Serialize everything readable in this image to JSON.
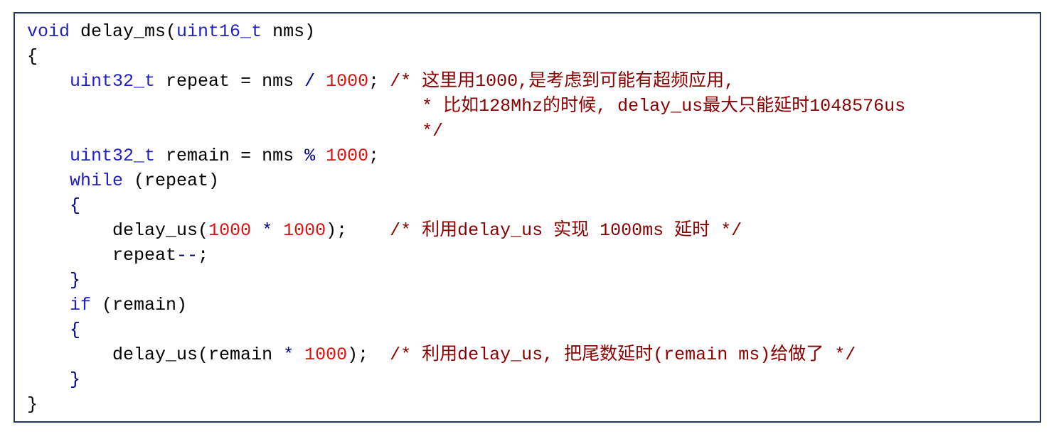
{
  "colors": {
    "keyword": "#1f1fc8",
    "number": "#e01010",
    "operator": "#000080",
    "comment": "#8b0000",
    "text": "#000000",
    "frame_border": "#1f3864"
  },
  "code": {
    "l1": {
      "kw": "void",
      "rest": " delay_ms(",
      "kw2": "uint16_t",
      "rest2": " nms)"
    },
    "l2": {
      "brace": "{"
    },
    "l3": {
      "indent": "    ",
      "kw": "uint32_t",
      "rest": " repeat = nms ",
      "op": "/",
      "sp": " ",
      "num": "1000",
      "semi": "; ",
      "cmt": "/* 这里用1000,是考虑到可能有超频应用,"
    },
    "l4": {
      "indent": "                                    ",
      "cmt": " * 比如128Mhz的时候, delay_us最大只能延时1048576us"
    },
    "l5": {
      "indent": "                                    ",
      "cmt": " */"
    },
    "l6": {
      "indent": "    ",
      "kw": "uint32_t",
      "rest": " remain = nms ",
      "op": "%",
      "sp": " ",
      "num": "1000",
      "semi": ";"
    },
    "l7": {
      "indent": "    ",
      "kw": "while",
      "rest": " (repeat)"
    },
    "l8": {
      "indent": "    ",
      "brace": "{"
    },
    "l9": {
      "indent": "        ",
      "rest": "delay_us(",
      "num": "1000",
      "op": " * ",
      "num2": "1000",
      "rest2": ");    ",
      "cmt": "/* 利用delay_us 实现 1000ms 延时 */"
    },
    "l10": {
      "indent": "        ",
      "rest": "repeat",
      "op": "--",
      "semi": ";"
    },
    "l11": {
      "indent": "    ",
      "brace": "}"
    },
    "l12": {
      "indent": "    ",
      "kw": "if",
      "rest": " (remain)"
    },
    "l13": {
      "indent": "    ",
      "brace": "{"
    },
    "l14": {
      "indent": "        ",
      "rest": "delay_us(remain ",
      "op": "*",
      "sp": " ",
      "num": "1000",
      "rest2": ");  ",
      "cmt": "/* 利用delay_us, 把尾数延时(remain ms)给做了 */"
    },
    "l15": {
      "indent": "    ",
      "brace": "}"
    },
    "l16": {
      "brace": "}"
    }
  }
}
